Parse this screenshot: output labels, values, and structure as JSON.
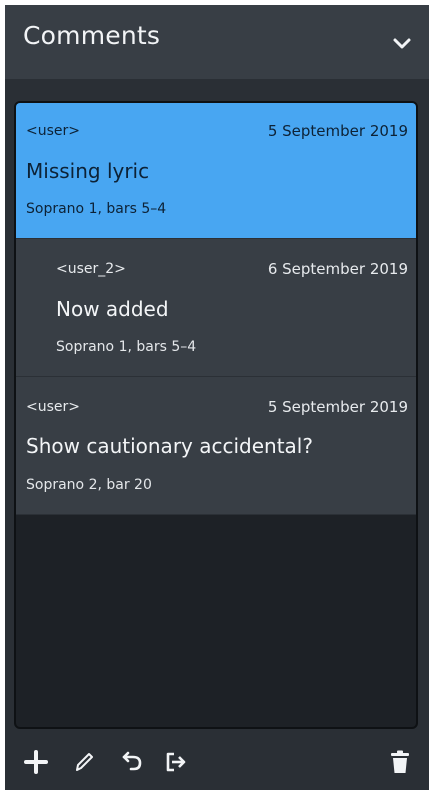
{
  "panel": {
    "title": "Comments",
    "collapse_icon": "chevron-down-icon"
  },
  "comments": [
    {
      "user": "<user>",
      "date": "5 September 2019",
      "text": "Missing lyric",
      "location": "Soprano 1, bars 5–4",
      "selected": true,
      "reply": false
    },
    {
      "user": "<user_2>",
      "date": "6 September 2019",
      "text": "Now added",
      "location": "Soprano 1, bars 5–4",
      "selected": false,
      "reply": true
    },
    {
      "user": "<user>",
      "date": "5 September 2019",
      "text": "Show cautionary accidental?",
      "location": "Soprano 2, bar 20",
      "selected": false,
      "reply": false
    }
  ],
  "toolbar": {
    "add_icon": "plus-icon",
    "edit_icon": "pencil-icon",
    "reply_icon": "reply-icon",
    "export_icon": "export-icon",
    "delete_icon": "trash-icon"
  },
  "colors": {
    "selected": "#48a6f2",
    "item": "#383e45",
    "list_background": "#1d2126",
    "panel_background": "#2a2f35"
  }
}
